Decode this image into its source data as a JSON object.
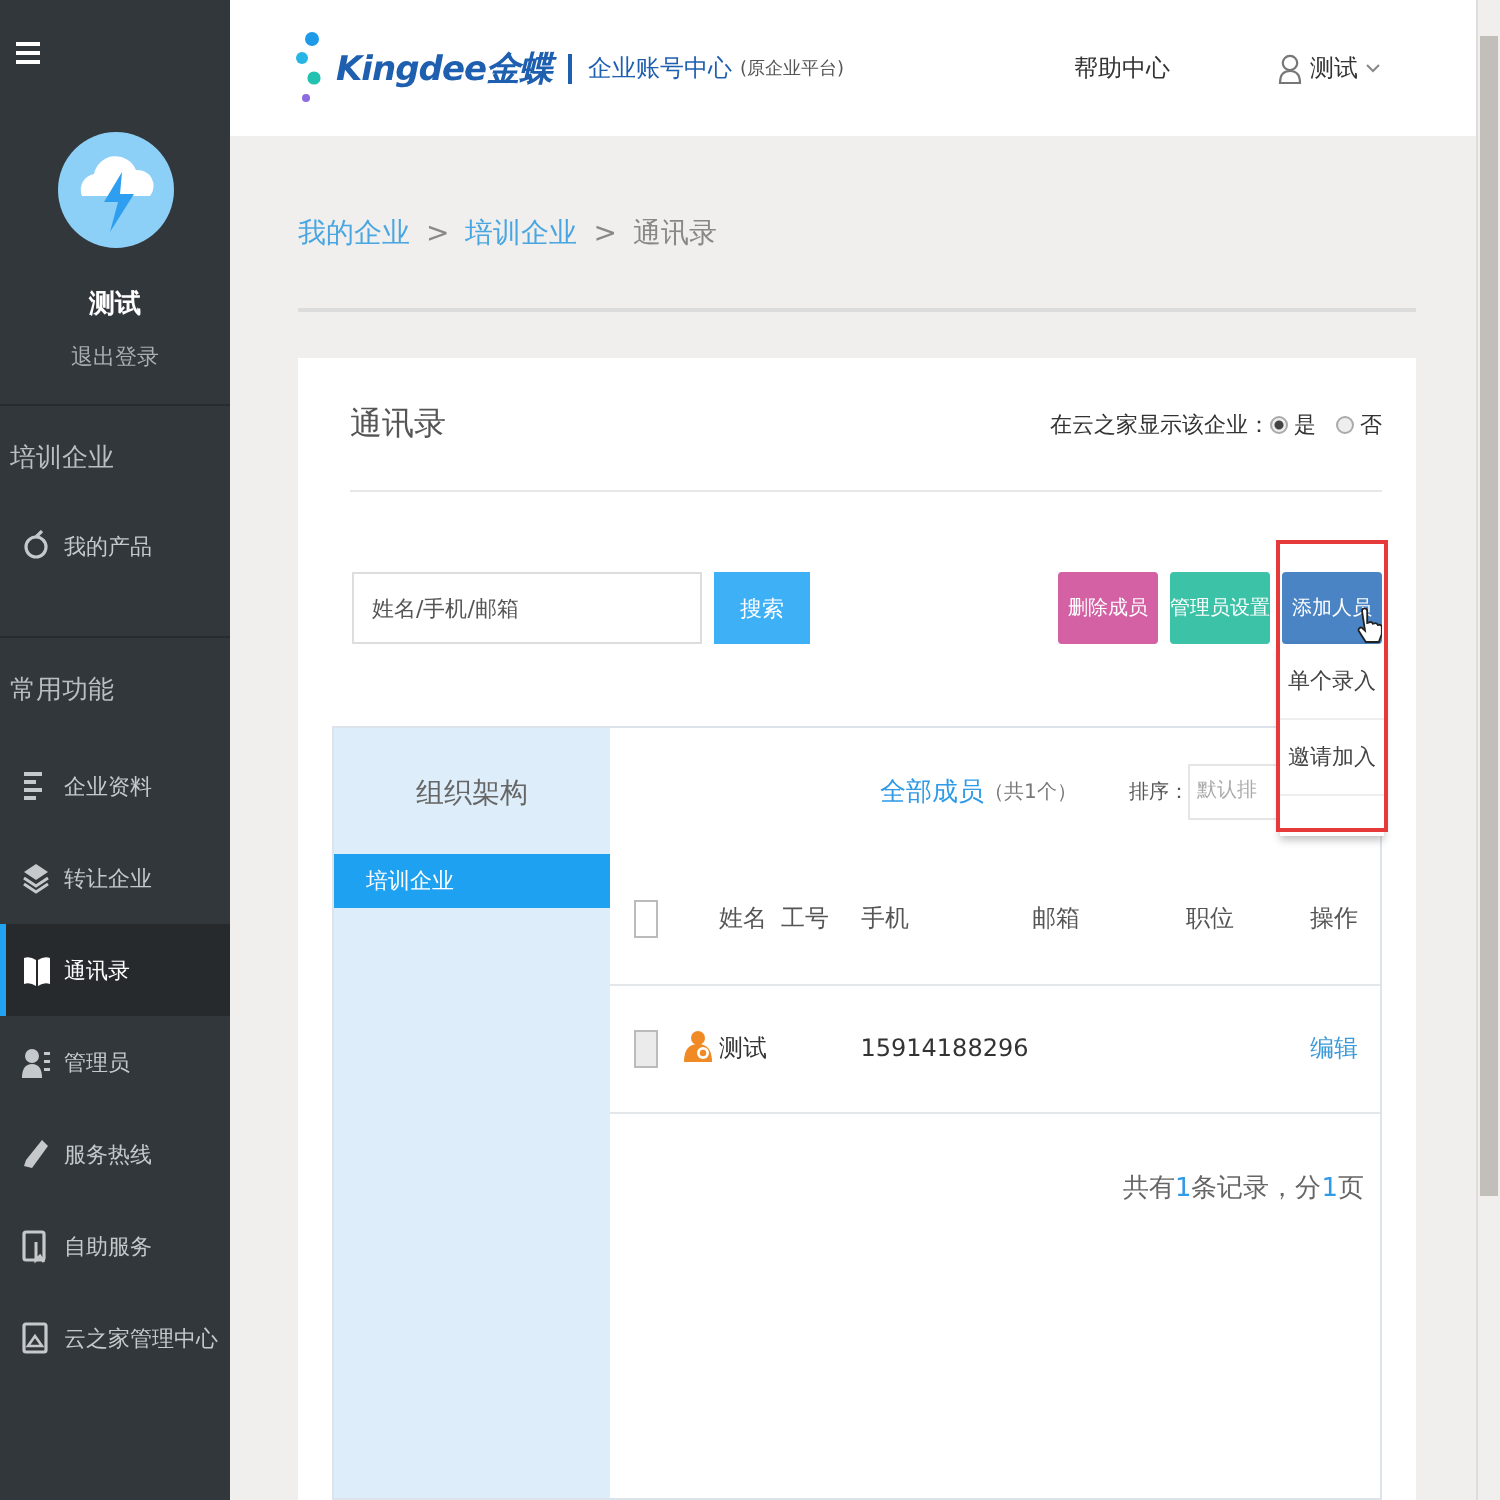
{
  "sidebar": {
    "user_name": "测试",
    "logout": "退出登录",
    "sections": [
      {
        "title": "培训企业",
        "items": [
          {
            "label": "我的产品",
            "selected": false
          }
        ]
      },
      {
        "title": "常用功能",
        "items": [
          {
            "label": "企业资料",
            "selected": false
          },
          {
            "label": "转让企业",
            "selected": false
          },
          {
            "label": "通讯录",
            "selected": true
          },
          {
            "label": "管理员",
            "selected": false
          },
          {
            "label": "服务热线",
            "selected": false
          },
          {
            "label": "自助服务",
            "selected": false
          },
          {
            "label": "云之家管理中心",
            "selected": false
          }
        ]
      }
    ]
  },
  "header": {
    "brand": "Kingdee金蝶",
    "product": "企业账号中心",
    "product_note": "(原企业平台)",
    "help": "帮助中心",
    "user": "测试"
  },
  "breadcrumb_separator": ">",
  "breadcrumb": [
    {
      "label": "我的企业",
      "link": true
    },
    {
      "label": "培训企业",
      "link": true
    },
    {
      "label": "通讯录",
      "link": false
    }
  ],
  "card": {
    "title": "通讯录",
    "visibility_label": "在云之家显示该企业：",
    "visibility_options": [
      {
        "label": "是",
        "selected": true
      },
      {
        "label": "否",
        "selected": false
      }
    ],
    "search": {
      "placeholder": "姓名/手机/邮箱",
      "button": "搜索"
    },
    "actions": [
      {
        "label": "删除成员",
        "kind": "delete"
      },
      {
        "label": "管理员设置",
        "kind": "admin"
      },
      {
        "label": "添加人员",
        "kind": "add"
      }
    ],
    "add_menu": [
      "单个录入",
      "邀请加入"
    ],
    "org": {
      "title": "组织架构",
      "items": [
        {
          "label": "培训企业",
          "selected": true
        }
      ]
    },
    "members": {
      "title": "全部成员",
      "count": "（共1个）",
      "sort_label": "排序：",
      "sort_value": "默认排",
      "select_all_checked": false,
      "columns": [
        "姓名",
        "工号",
        "手机",
        "邮箱",
        "职位",
        "操作"
      ],
      "rows": [
        {
          "checked": false,
          "name": "测试",
          "phone": "15914188296",
          "action": "编辑"
        }
      ],
      "pager": [
        {
          "text": "共有",
          "highlight": false
        },
        {
          "text": "1",
          "highlight": true
        },
        {
          "text": "条记录，分",
          "highlight": false
        },
        {
          "text": "1",
          "highlight": true
        },
        {
          "text": "页",
          "highlight": false
        }
      ]
    }
  }
}
